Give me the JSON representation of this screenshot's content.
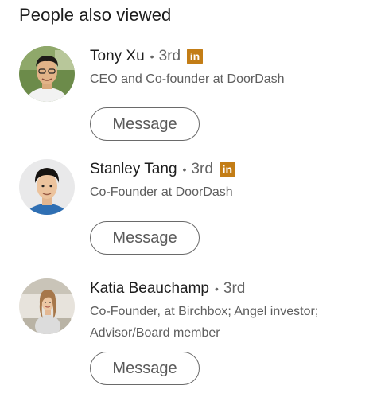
{
  "section": {
    "title": "People also viewed"
  },
  "people": [
    {
      "name": "Tony Xu",
      "separator": "•",
      "degree": "3rd",
      "premium_badge": "in",
      "headline": "CEO and Co-founder at DoorDash",
      "button_label": "Message"
    },
    {
      "name": "Stanley Tang",
      "separator": "•",
      "degree": "3rd",
      "premium_badge": "in",
      "headline": "Co-Founder at DoorDash",
      "button_label": "Message"
    },
    {
      "name": "Katia Beauchamp",
      "separator": "•",
      "degree": "3rd",
      "headline": "Co-Founder, at Birchbox; Angel investor; Advisor/Board member",
      "button_label": "Message"
    }
  ],
  "colors": {
    "premium_badge": "#c37d16",
    "button_border": "#6a6a6a",
    "secondary_text": "#5e5e5e"
  }
}
